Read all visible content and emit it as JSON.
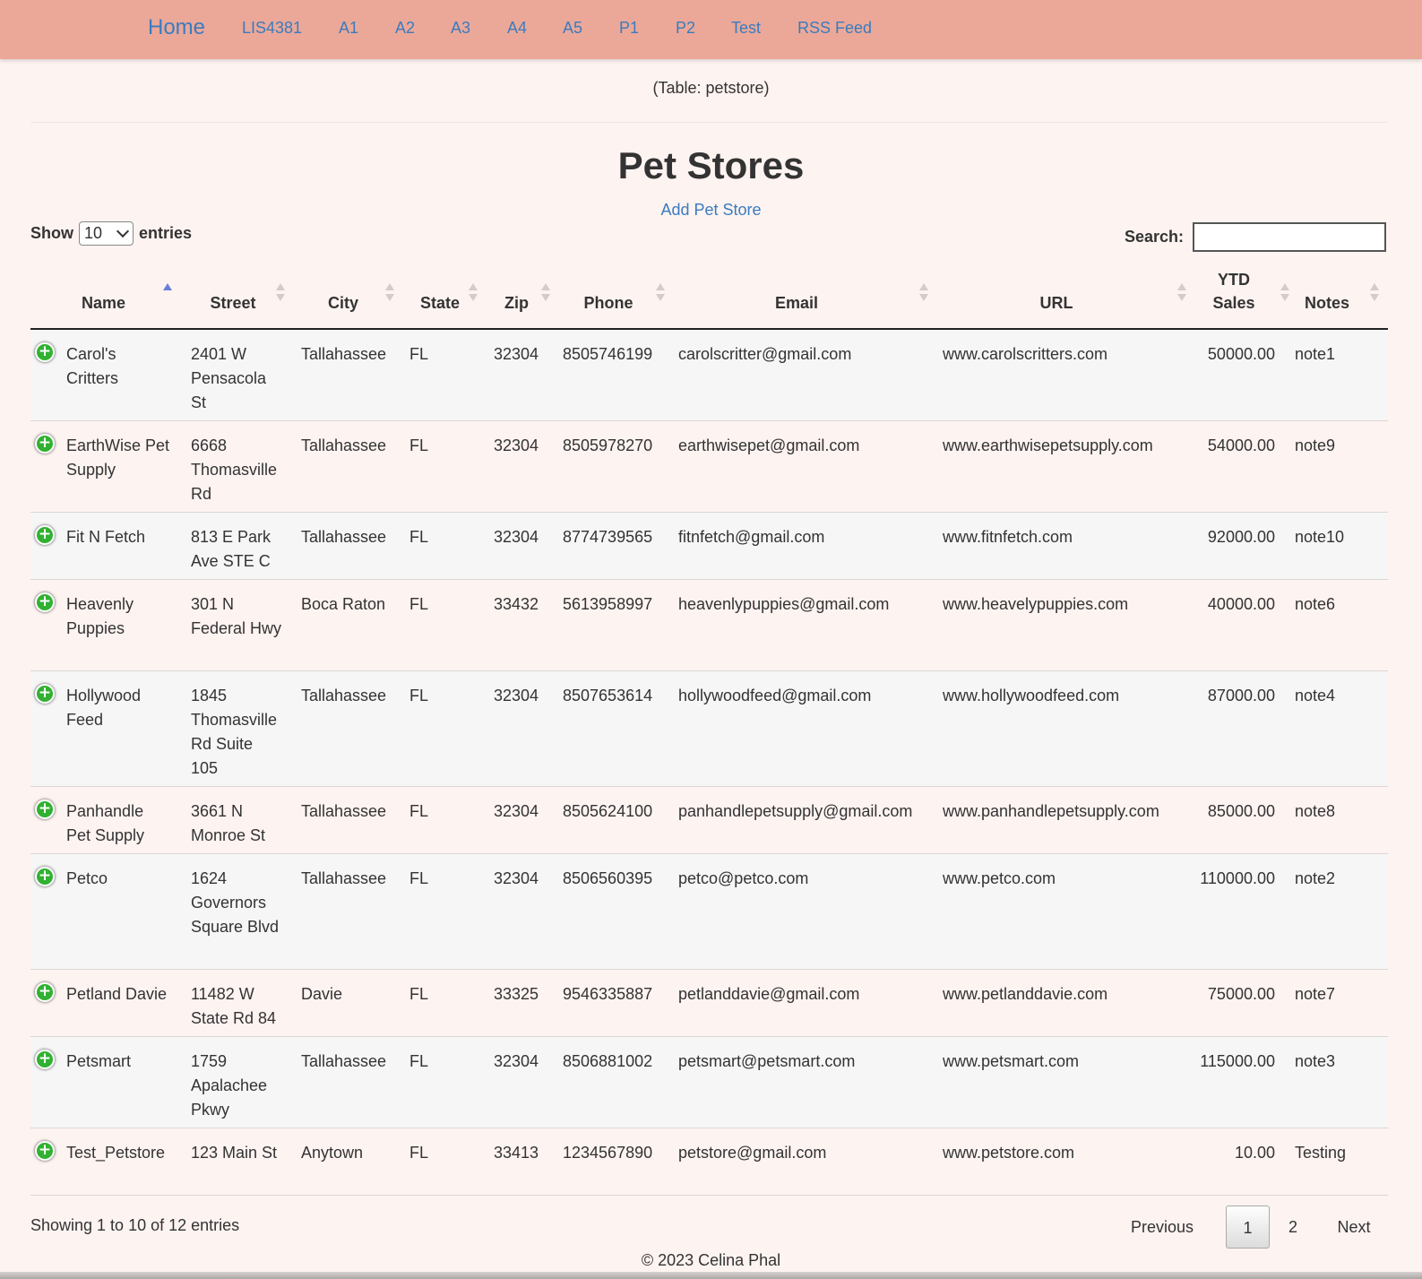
{
  "nav": {
    "brand": "Home",
    "links": [
      "LIS4381",
      "A1",
      "A2",
      "A3",
      "A4",
      "A5",
      "P1",
      "P2",
      "Test",
      "RSS Feed"
    ]
  },
  "header": {
    "subtitle": "(Table: petstore)",
    "title": "Pet Stores",
    "add_link": "Add Pet Store"
  },
  "length": {
    "show_label": "Show",
    "selected": "10",
    "entries_label": "entries"
  },
  "search": {
    "label": "Search:",
    "value": ""
  },
  "table": {
    "columns": [
      "Name",
      "Street",
      "City",
      "State",
      "Zip",
      "Phone",
      "Email",
      "URL",
      "YTD Sales",
      "Notes"
    ],
    "sorted_column": "Name",
    "sort_direction": "ascending",
    "rows": [
      [
        "Carol's Critters",
        "2401 W Pensacola St",
        "Tallahassee",
        "FL",
        "32304",
        "8505746199",
        "carolscritter@gmail.com",
        "www.carolscritters.com",
        "50000.00",
        "note1"
      ],
      [
        "EarthWise Pet Supply",
        "6668 Thomasville Rd",
        "Tallahassee",
        "FL",
        "32304",
        "8505978270",
        "earthwisepet@gmail.com",
        "www.earthwisepetsupply.com",
        "54000.00",
        "note9"
      ],
      [
        "Fit N Fetch",
        "813 E Park Ave STE C",
        "Tallahassee",
        "FL",
        "32304",
        "8774739565",
        "fitnfetch@gmail.com",
        "www.fitnfetch.com",
        "92000.00",
        "note10"
      ],
      [
        "Heavenly Puppies",
        "301 N Federal Hwy",
        "Boca Raton",
        "FL",
        "33432",
        "5613958997",
        "heavenlypuppies@gmail.com",
        "www.heavelypuppies.com",
        "40000.00",
        "note6"
      ],
      [
        "Hollywood Feed",
        "1845 Thomasville Rd Suite 105",
        "Tallahassee",
        "FL",
        "32304",
        "8507653614",
        "hollywoodfeed@gmail.com",
        "www.hollywoodfeed.com",
        "87000.00",
        "note4"
      ],
      [
        "Panhandle Pet Supply",
        "3661 N Monroe St",
        "Tallahassee",
        "FL",
        "32304",
        "8505624100",
        "panhandlepetsupply@gmail.com",
        "www.panhandlepetsupply.com",
        "85000.00",
        "note8"
      ],
      [
        "Petco",
        "1624 Governors Square Blvd",
        "Tallahassee",
        "FL",
        "32304",
        "8506560395",
        "petco@petco.com",
        "www.petco.com",
        "110000.00",
        "note2"
      ],
      [
        "Petland Davie",
        "11482 W State Rd 84",
        "Davie",
        "FL",
        "33325",
        "9546335887",
        "petlanddavie@gmail.com",
        "www.petlanddavie.com",
        "75000.00",
        "note7"
      ],
      [
        "Petsmart",
        "1759 Apalachee Pkwy",
        "Tallahassee",
        "FL",
        "32304",
        "8506881002",
        "petsmart@petsmart.com",
        "www.petsmart.com",
        "115000.00",
        "note3"
      ],
      [
        "Test_Petstore",
        "123 Main St",
        "Anytown",
        "FL",
        "33413",
        "1234567890",
        "petstore@gmail.com",
        "www.petstore.com",
        "10.00",
        "Testing"
      ]
    ]
  },
  "info": "Showing 1 to 10 of 12 entries",
  "pagination": {
    "previous": "Previous",
    "pages": [
      "1",
      "2"
    ],
    "current": "1",
    "next": "Next"
  },
  "footer": "© 2023 Celina Phal",
  "colors": {
    "navbar": "#eba898",
    "link": "#3b7bbf",
    "background": "#fdf3f1",
    "expand_button": "#31b131"
  }
}
